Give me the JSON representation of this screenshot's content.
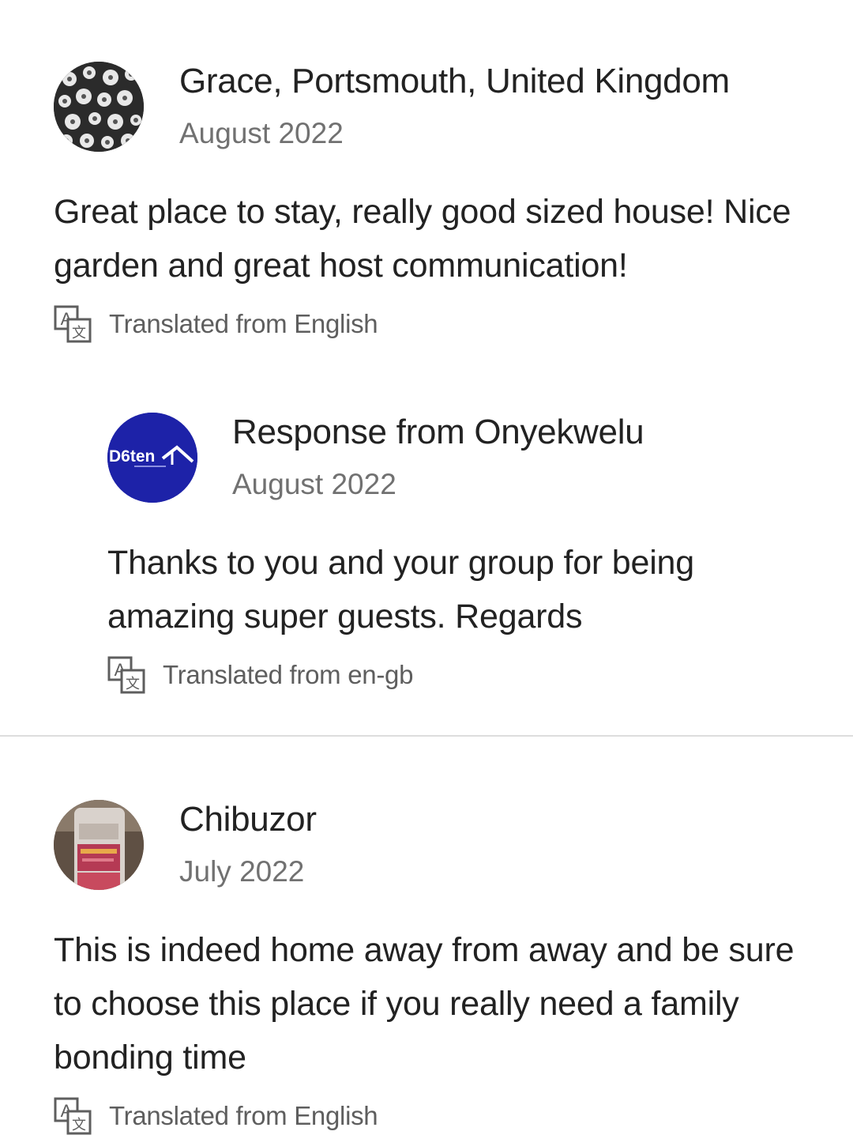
{
  "reviews": [
    {
      "author": "Grace, Portsmouth, United Kingdom",
      "date": "August 2022",
      "text": "Great place to stay, really good sized house! Nice garden and great host communication!",
      "translated_label": "Translated from English",
      "avatar_icon": "daisy-photo-avatar",
      "response": {
        "author": "Response from Onyekwelu",
        "date": "August 2022",
        "text": "Thanks to you and your group for being amazing super guests. Regards",
        "translated_label": "Translated from en-gb",
        "avatar_icon": "d6ten-logo-avatar",
        "avatar_logo_text": "D6ten",
        "avatar_color": "#1d22a8"
      }
    },
    {
      "author": "Chibuzor",
      "date": "July 2022",
      "text": "This is indeed home away from away and be sure  to choose this place if you really need a family bonding time",
      "translated_label": "Translated from English",
      "avatar_icon": "bottle-photo-avatar"
    }
  ],
  "colors": {
    "text": "#222222",
    "muted": "#717171",
    "divider": "#dddddd",
    "host_brand": "#1d22a8"
  }
}
